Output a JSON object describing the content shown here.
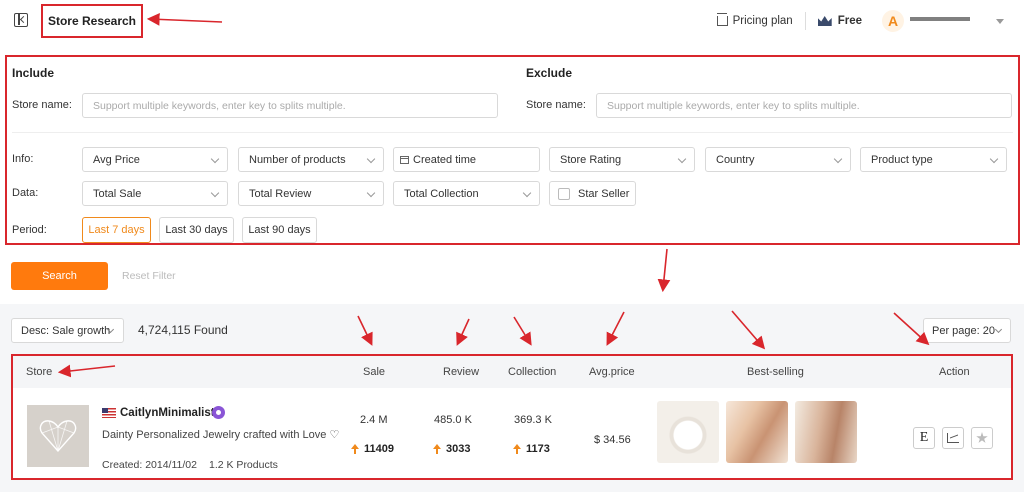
{
  "header": {
    "title": "Store Research",
    "pricing_label": "Pricing plan",
    "plan_label": "Free",
    "avatar_letter": "A"
  },
  "filters": {
    "include_title": "Include",
    "exclude_title": "Exclude",
    "store_name_label": "Store name:",
    "store_name_placeholder": "Support multiple keywords, enter key to splits multiple.",
    "info_label": "Info:",
    "data_label": "Data:",
    "period_label": "Period",
    "info_selects": [
      "Avg Price",
      "Number of products",
      "Created time",
      "Store Rating",
      "Country",
      "Product type"
    ],
    "data_selects": [
      "Total Sale",
      "Total Review",
      "Total Collection"
    ],
    "star_seller_label": "Star Seller",
    "periods": [
      "Last 7 days",
      "Last 30 days",
      "Last 90 days"
    ],
    "active_period": "Last 7 days"
  },
  "actions": {
    "search_label": "Search",
    "reset_label": "Reset Filter"
  },
  "results": {
    "sort_value": "Desc: Sale growth",
    "found_text": "4,724,115 Found",
    "per_page_value": "Per page: 20",
    "columns": [
      "Store",
      "Sale",
      "Review",
      "Collection",
      "Avg.price",
      "Best-selling",
      "Action"
    ],
    "rows": [
      {
        "store_name": "CaitlynMinimalist",
        "description": "Dainty Personalized Jewelry crafted with Love ♡",
        "created": "Created: 2014/11/02",
        "products": "1.2 K Products",
        "sale": "2.4 M",
        "sale_growth": "11409",
        "review": "485.0 K",
        "review_growth": "3033",
        "collection": "369.3 K",
        "collection_growth": "1173",
        "avg_price": "$ 34.56"
      }
    ]
  },
  "colors": {
    "accent": "#ff7a0d",
    "annotation": "#d9262c",
    "verified": "#8a55d6"
  },
  "icons": [
    "collapse-sidebar-icon",
    "pricing-plan-icon",
    "crown-icon",
    "calendar-icon",
    "us-flag-icon",
    "verified-badge-icon",
    "etsy-icon",
    "analytics-chart-icon",
    "favorite-star-icon",
    "growth-up-arrow-icon"
  ]
}
